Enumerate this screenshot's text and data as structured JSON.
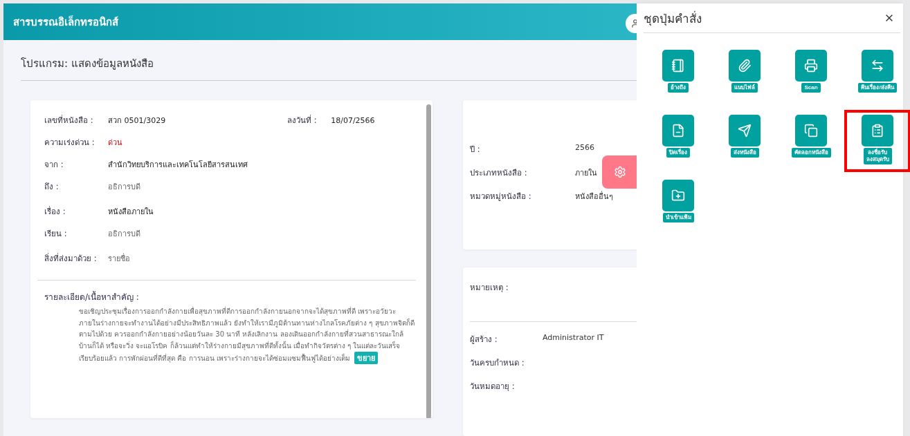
{
  "app_bar": {
    "title": "สารบรรณอิเล็กทรอนิกส์"
  },
  "page_title": "โปรแกรม: แสดงข้อมูลหนังสือ",
  "document": {
    "number": {
      "label": "เลขที่หนังสือ :",
      "value": "สวก 0501/3029"
    },
    "date": {
      "label": "ลงวันที่ :",
      "value": "18/07/2566"
    },
    "fields": [
      {
        "label": "ความเร่งด่วน :",
        "value": "ด่วน",
        "kind": "urgent"
      },
      {
        "label": "จาก :",
        "value": "สำนักวิทยบริการและเทคโนโลยีสารสนเทศ",
        "kind": "strong"
      },
      {
        "label": "ถึง :",
        "value": "อธิการบดี",
        "kind": "muted"
      },
      {
        "label": "เรื่อง :",
        "value": "หนังสือภายใน",
        "kind": "strong"
      },
      {
        "label": "เรียน :",
        "value": "อธิการบดี",
        "kind": "muted"
      },
      {
        "label": "สิ่งที่ส่งมาด้วย :",
        "value": "รายชื่อ",
        "kind": "muted"
      }
    ],
    "detail": {
      "label": "รายละเอียด/เนื้อหาสำคัญ :",
      "text": "ขอเชิญประชุมเรื่องการออกกำลังกายเพื่อสุขภาพที่ดีการออกกำลังกายนอกจากจะได้สุขภาพที่ดี เพราะอวัยวะภายในร่างกายจะทำงานได้อย่างมีประสิทธิภาพแล้ว ยังทำให้เรามีภูมิต้านทานห่างไกลโรคภัยต่าง ๆ สุขภาพจิตก็ดีตามไปด้วย ควรออกกำลังกายอย่างน้อยวันละ 30 นาที หลังเลิกงาน ลองเดินออกกำลังกายที่สวนสาธารณะใกล้บ้านก็ได้ หรือจะวิ่ง จะแอโรบิค ก็ล้วนแต่ทำให้ร่างกายมีสุขภาพที่ดีทั้งนั้น เมื่อทำกิจวัตรต่าง ๆ ในแต่ละวันเสร็จเรียบร้อยแล้ว การพักผ่อนที่ดีที่สุด คือ การนอน เพราะร่างกายจะได้ซ่อมแซมฟื้นฟูได้อย่างเต็ม",
      "more": "ขยาย"
    }
  },
  "info": {
    "fields": [
      {
        "label": "ปี :",
        "value": "2566"
      },
      {
        "label": "ประเภทหนังสือ :",
        "value": "ภายใน"
      },
      {
        "label": "หมวดหมู่หนังสือ :",
        "value": "หนังสืออื่นๆ"
      }
    ]
  },
  "note": {
    "label": "หมายเหตุ :",
    "fields": [
      {
        "label": "ผู้สร้าง :",
        "value": "Administrator IT"
      },
      {
        "label": "วันครบกำหนด :"
      },
      {
        "label": "วันหมดอายุ :"
      }
    ]
  },
  "drawer": {
    "title": "ชุดปุ่มคำสั่ง",
    "commands": [
      {
        "label": "อ้างถึง",
        "kind": "notebook",
        "highlighted": false
      },
      {
        "label": "แนบไฟล์",
        "kind": "paperclip",
        "highlighted": false
      },
      {
        "label": "Scan",
        "kind": "scan",
        "highlighted": false
      },
      {
        "label": "คืนเรื่อง/ส่งคืน",
        "kind": "swap",
        "highlighted": false
      },
      {
        "label": "ปิดเรื่อง",
        "kind": "closefile",
        "highlighted": false
      },
      {
        "label": "ส่งหนังสือ",
        "kind": "send",
        "highlighted": false
      },
      {
        "label": "คัดลอกหนังสือ",
        "kind": "copy",
        "highlighted": false
      },
      {
        "label": "ลงชื่อรับ\nลงสมุดรับ",
        "kind": "clipboard",
        "highlighted": true
      },
      {
        "label": "นำเข้าแฟ้ม",
        "kind": "folderplus",
        "highlighted": false
      }
    ]
  }
}
